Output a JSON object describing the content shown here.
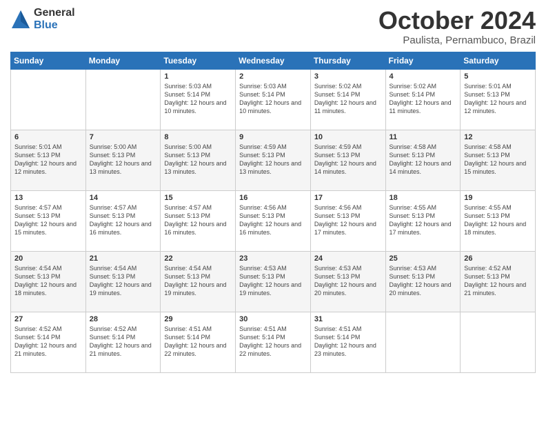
{
  "logo": {
    "general": "General",
    "blue": "Blue"
  },
  "header": {
    "month": "October 2024",
    "location": "Paulista, Pernambuco, Brazil"
  },
  "weekdays": [
    "Sunday",
    "Monday",
    "Tuesday",
    "Wednesday",
    "Thursday",
    "Friday",
    "Saturday"
  ],
  "weeks": [
    [
      null,
      null,
      {
        "day": "1",
        "sunrise": "5:03 AM",
        "sunset": "5:14 PM",
        "daylight": "12 hours and 10 minutes."
      },
      {
        "day": "2",
        "sunrise": "5:03 AM",
        "sunset": "5:14 PM",
        "daylight": "12 hours and 10 minutes."
      },
      {
        "day": "3",
        "sunrise": "5:02 AM",
        "sunset": "5:14 PM",
        "daylight": "12 hours and 11 minutes."
      },
      {
        "day": "4",
        "sunrise": "5:02 AM",
        "sunset": "5:14 PM",
        "daylight": "12 hours and 11 minutes."
      },
      {
        "day": "5",
        "sunrise": "5:01 AM",
        "sunset": "5:13 PM",
        "daylight": "12 hours and 12 minutes."
      }
    ],
    [
      {
        "day": "6",
        "sunrise": "5:01 AM",
        "sunset": "5:13 PM",
        "daylight": "12 hours and 12 minutes."
      },
      {
        "day": "7",
        "sunrise": "5:00 AM",
        "sunset": "5:13 PM",
        "daylight": "12 hours and 13 minutes."
      },
      {
        "day": "8",
        "sunrise": "5:00 AM",
        "sunset": "5:13 PM",
        "daylight": "12 hours and 13 minutes."
      },
      {
        "day": "9",
        "sunrise": "4:59 AM",
        "sunset": "5:13 PM",
        "daylight": "12 hours and 13 minutes."
      },
      {
        "day": "10",
        "sunrise": "4:59 AM",
        "sunset": "5:13 PM",
        "daylight": "12 hours and 14 minutes."
      },
      {
        "day": "11",
        "sunrise": "4:58 AM",
        "sunset": "5:13 PM",
        "daylight": "12 hours and 14 minutes."
      },
      {
        "day": "12",
        "sunrise": "4:58 AM",
        "sunset": "5:13 PM",
        "daylight": "12 hours and 15 minutes."
      }
    ],
    [
      {
        "day": "13",
        "sunrise": "4:57 AM",
        "sunset": "5:13 PM",
        "daylight": "12 hours and 15 minutes."
      },
      {
        "day": "14",
        "sunrise": "4:57 AM",
        "sunset": "5:13 PM",
        "daylight": "12 hours and 16 minutes."
      },
      {
        "day": "15",
        "sunrise": "4:57 AM",
        "sunset": "5:13 PM",
        "daylight": "12 hours and 16 minutes."
      },
      {
        "day": "16",
        "sunrise": "4:56 AM",
        "sunset": "5:13 PM",
        "daylight": "12 hours and 16 minutes."
      },
      {
        "day": "17",
        "sunrise": "4:56 AM",
        "sunset": "5:13 PM",
        "daylight": "12 hours and 17 minutes."
      },
      {
        "day": "18",
        "sunrise": "4:55 AM",
        "sunset": "5:13 PM",
        "daylight": "12 hours and 17 minutes."
      },
      {
        "day": "19",
        "sunrise": "4:55 AM",
        "sunset": "5:13 PM",
        "daylight": "12 hours and 18 minutes."
      }
    ],
    [
      {
        "day": "20",
        "sunrise": "4:54 AM",
        "sunset": "5:13 PM",
        "daylight": "12 hours and 18 minutes."
      },
      {
        "day": "21",
        "sunrise": "4:54 AM",
        "sunset": "5:13 PM",
        "daylight": "12 hours and 19 minutes."
      },
      {
        "day": "22",
        "sunrise": "4:54 AM",
        "sunset": "5:13 PM",
        "daylight": "12 hours and 19 minutes."
      },
      {
        "day": "23",
        "sunrise": "4:53 AM",
        "sunset": "5:13 PM",
        "daylight": "12 hours and 19 minutes."
      },
      {
        "day": "24",
        "sunrise": "4:53 AM",
        "sunset": "5:13 PM",
        "daylight": "12 hours and 20 minutes."
      },
      {
        "day": "25",
        "sunrise": "4:53 AM",
        "sunset": "5:13 PM",
        "daylight": "12 hours and 20 minutes."
      },
      {
        "day": "26",
        "sunrise": "4:52 AM",
        "sunset": "5:13 PM",
        "daylight": "12 hours and 21 minutes."
      }
    ],
    [
      {
        "day": "27",
        "sunrise": "4:52 AM",
        "sunset": "5:14 PM",
        "daylight": "12 hours and 21 minutes."
      },
      {
        "day": "28",
        "sunrise": "4:52 AM",
        "sunset": "5:14 PM",
        "daylight": "12 hours and 21 minutes."
      },
      {
        "day": "29",
        "sunrise": "4:51 AM",
        "sunset": "5:14 PM",
        "daylight": "12 hours and 22 minutes."
      },
      {
        "day": "30",
        "sunrise": "4:51 AM",
        "sunset": "5:14 PM",
        "daylight": "12 hours and 22 minutes."
      },
      {
        "day": "31",
        "sunrise": "4:51 AM",
        "sunset": "5:14 PM",
        "daylight": "12 hours and 23 minutes."
      },
      null,
      null
    ]
  ],
  "labels": {
    "sunrise": "Sunrise:",
    "sunset": "Sunset:",
    "daylight": "Daylight:"
  }
}
